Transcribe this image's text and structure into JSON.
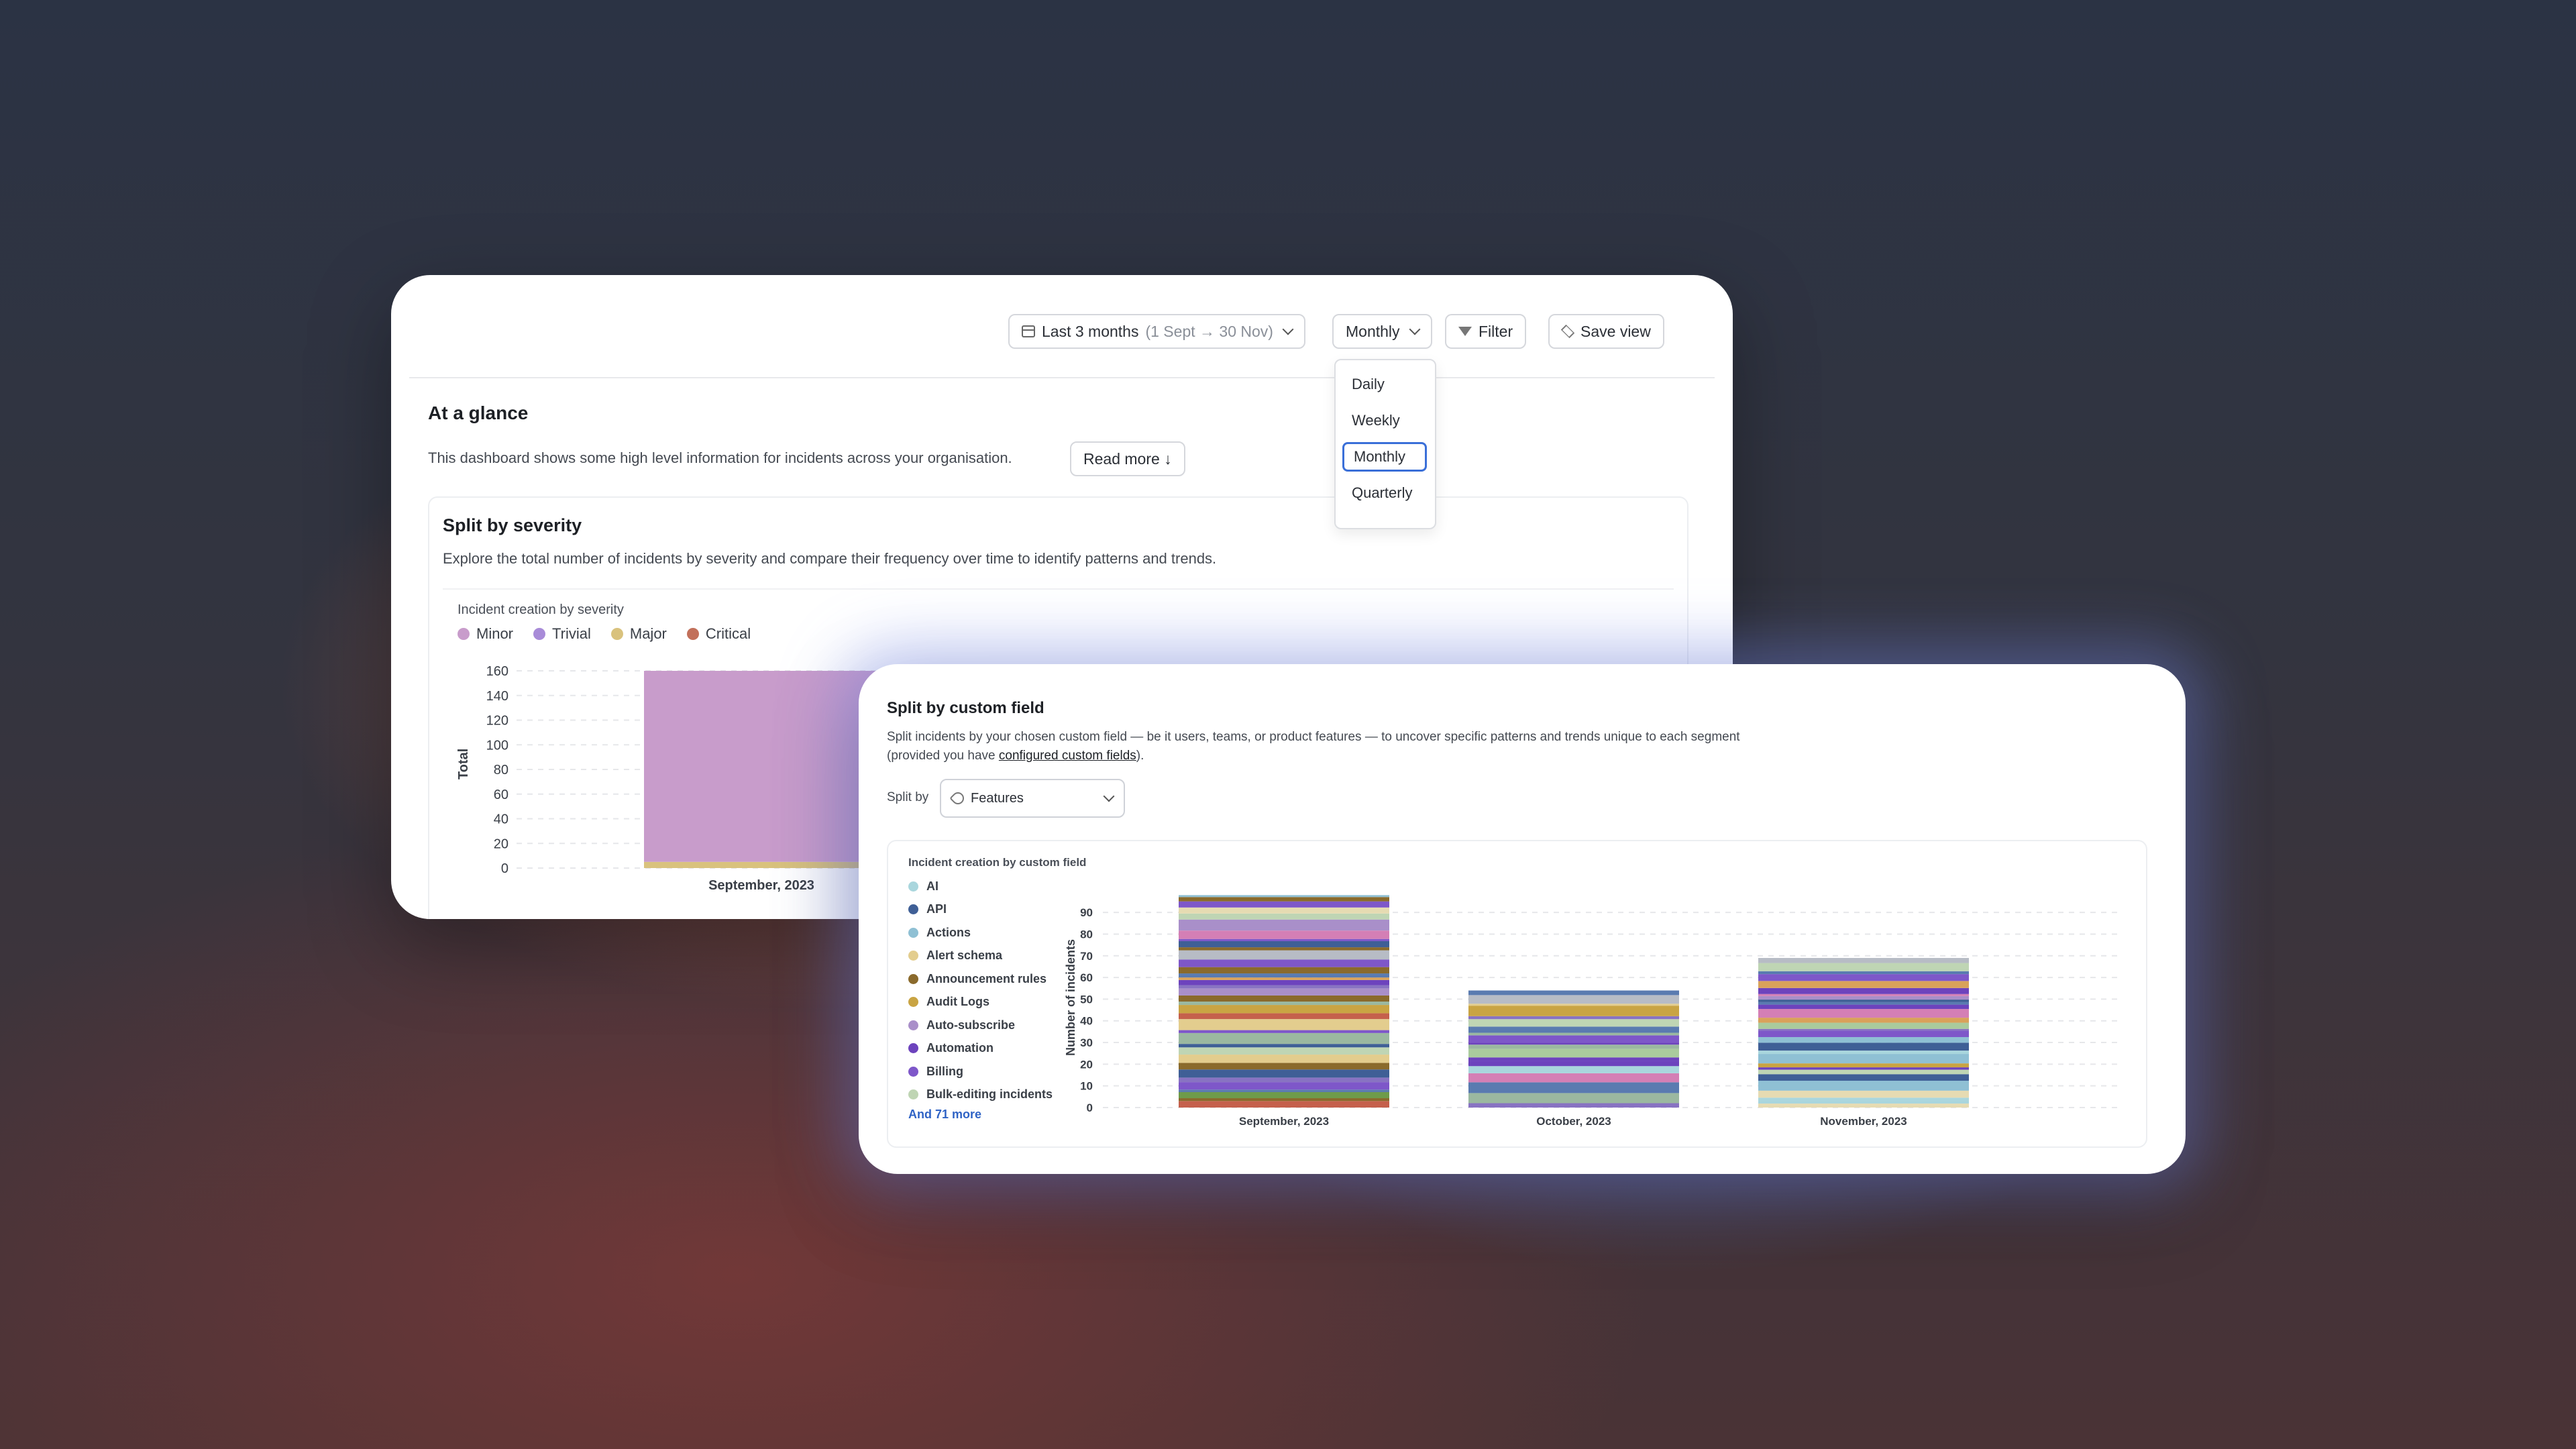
{
  "toolbar": {
    "range_label": "Last 3 months",
    "range_detail": "(1 Sept → 30 Nov)",
    "granularity_label": "Monthly",
    "filter_label": "Filter",
    "save_view_label": "Save view"
  },
  "granularity_menu": {
    "options": [
      "Daily",
      "Weekly",
      "Monthly",
      "Quarterly"
    ],
    "selected": "Monthly"
  },
  "glance": {
    "title": "At a glance",
    "description": "This dashboard shows some high level information for incidents across your organisation.",
    "read_more_label": "Read more ↓"
  },
  "severity": {
    "title": "Split by severity",
    "description": "Explore the total number of incidents by severity and compare their frequency over time to identify patterns and trends."
  },
  "custom_field": {
    "title": "Split by custom field",
    "description_start": "Split incidents by your chosen custom field — be it users, teams, or product features — to uncover specific patterns and trends unique to each segment (provided you have ",
    "description_link": "configured custom fields",
    "description_end": ").",
    "split_by_label": "Split by",
    "split_by_value": "Features",
    "and_more": "And 71 more"
  },
  "chart_data": [
    {
      "type": "bar",
      "title": "Incident creation by severity",
      "ylabel": "Total",
      "ylim": [
        0,
        160
      ],
      "yticks": [
        0,
        20,
        40,
        60,
        80,
        100,
        120,
        140,
        160
      ],
      "categories": [
        "September, 2023"
      ],
      "series": [
        {
          "name": "Minor",
          "color": "#c89ccb",
          "values": [
            155
          ]
        },
        {
          "name": "Trivial",
          "color": "#a88bd8",
          "values": [
            0
          ]
        },
        {
          "name": "Major",
          "color": "#d9c27d",
          "values": [
            5
          ]
        },
        {
          "name": "Critical",
          "color": "#c2705a",
          "values": [
            0
          ]
        }
      ]
    },
    {
      "type": "bar",
      "title": "Incident creation by custom field",
      "ylabel": "Number of incidents",
      "ylim": [
        0,
        95
      ],
      "yticks": [
        0,
        10,
        20,
        30,
        40,
        50,
        60,
        70,
        80,
        90
      ],
      "categories": [
        "September, 2023",
        "October, 2023",
        "November, 2023"
      ],
      "series": [
        {
          "name": "AI",
          "color": "#a9d6dd"
        },
        {
          "name": "API",
          "color": "#3f5f96"
        },
        {
          "name": "Actions",
          "color": "#8fc0d4"
        },
        {
          "name": "Alert schema",
          "color": "#e3cd8e"
        },
        {
          "name": "Announcement rules",
          "color": "#8a6a2c"
        },
        {
          "name": "Audit Logs",
          "color": "#c9a443"
        },
        {
          "name": "Auto-subscribe",
          "color": "#a98fc9"
        },
        {
          "name": "Automation",
          "color": "#6d43bd"
        },
        {
          "name": "Billing",
          "color": "#7e57c9"
        },
        {
          "name": "Bulk-editing incidents",
          "color": "#bfd5b4"
        }
      ],
      "totals": [
        98,
        54,
        69
      ]
    }
  ]
}
